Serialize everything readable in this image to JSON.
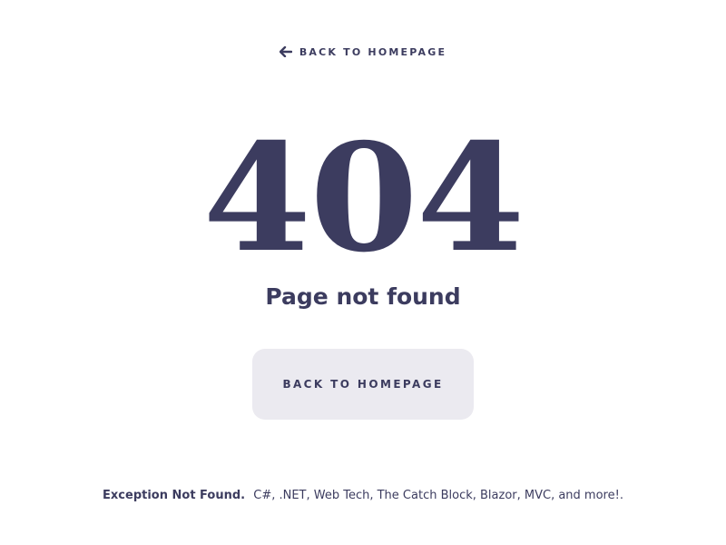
{
  "nav": {
    "back_link_label": "BACK TO HOMEPAGE",
    "back_icon": "arrow-left-icon"
  },
  "error": {
    "code": "404",
    "message": "Page not found"
  },
  "actions": {
    "home_button_label": "BACK TO HOMEPAGE"
  },
  "footer": {
    "brand": "Exception Not Found.",
    "tagline": "C#, .NET, Web Tech, The Catch Block, Blazor, MVC, and more!."
  },
  "colors": {
    "primary_text": "#3c3c5f",
    "button_bg": "#ebeaf0",
    "background": "#ffffff"
  }
}
